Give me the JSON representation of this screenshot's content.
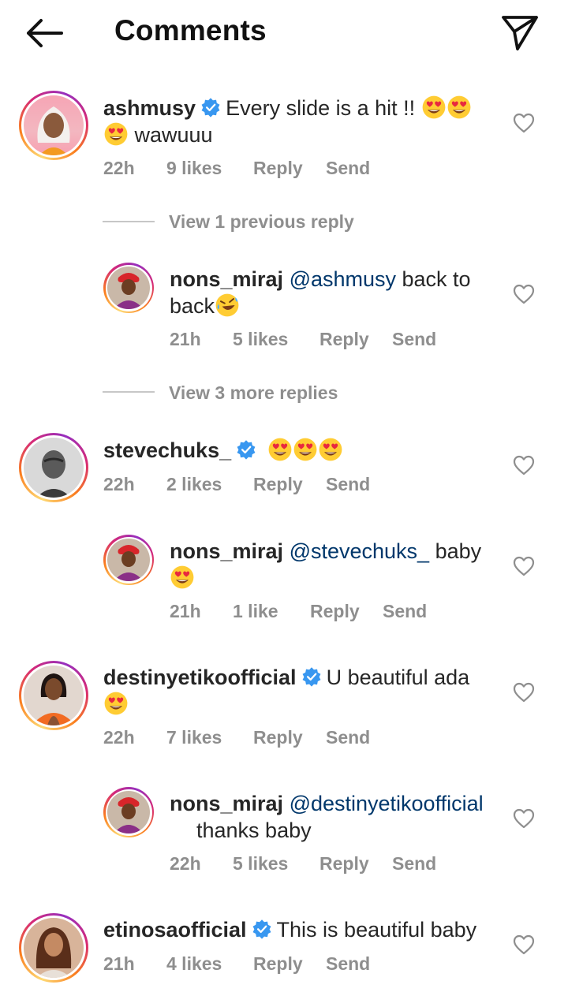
{
  "header": {
    "title": "Comments"
  },
  "comments": [
    {
      "username": "ashmusy",
      "text_a": "Every slide is a hit !! ",
      "text_b": " wawuuu",
      "time": "22h",
      "likes": "9 likes",
      "reply": "Reply",
      "send": "Send"
    },
    {
      "view_prev": "View 1 previous reply",
      "username": "nons_miraj",
      "mention": "@ashmusy",
      "text_a": " back to",
      "text_b": "back",
      "time": "21h",
      "likes": "5 likes",
      "reply": "Reply",
      "send": "Send"
    },
    {
      "view_more": "View 3 more replies",
      "username": "stevechuks_",
      "time": "22h",
      "likes": "2 likes",
      "reply": "Reply",
      "send": "Send"
    },
    {
      "username": "nons_miraj",
      "mention": "@stevechuks_",
      "text_a": " baby",
      "time": "21h",
      "likes": "1 like",
      "reply": "Reply",
      "send": "Send"
    },
    {
      "username": "destinyetikoofficial",
      "text_a": "U beautiful ada",
      "time": "22h",
      "likes": "7 likes",
      "reply": "Reply",
      "send": "Send"
    },
    {
      "username": "nons_miraj",
      "mention": "@destinyetikoofficial",
      "text_b": "thanks baby",
      "time": "22h",
      "likes": "5 likes",
      "reply": "Reply",
      "send": "Send"
    },
    {
      "username": "etinosaofficial",
      "text_a": "This is beautiful baby",
      "time": "21h",
      "likes": "4 likes",
      "reply": "Reply",
      "send": "Send"
    }
  ],
  "icons": [
    "back-arrow-icon",
    "send-icon",
    "verified-icon",
    "heart-icon",
    "heart-eyes-emoji",
    "rofl-emoji"
  ],
  "colors": {
    "verified": "#3897f0",
    "mention": "#00376b",
    "meta": "#8e8e8e"
  }
}
